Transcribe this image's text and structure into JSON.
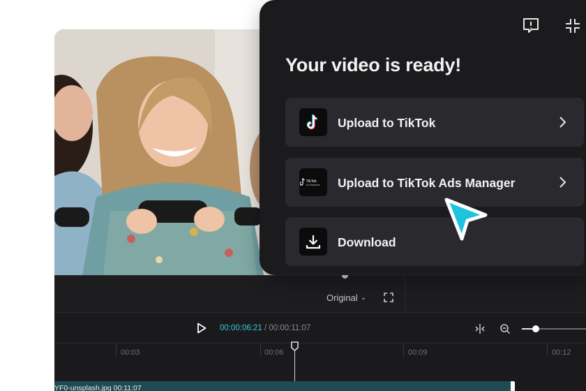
{
  "export_panel": {
    "title": "Your video is ready!",
    "options": [
      {
        "label": "Upload to TikTok",
        "icon": "tiktok-logo-icon"
      },
      {
        "label": "Upload to TikTok Ads Manager",
        "icon": "tiktok-for-business-logo-icon",
        "logo_text": "TikTok",
        "logo_subtext": "for Business"
      },
      {
        "label": "Download",
        "icon": "download-icon"
      }
    ],
    "header_icons": [
      "feedback-icon",
      "collapse-icon"
    ]
  },
  "preview": {
    "ratio_label": "Original"
  },
  "transport": {
    "current_time": "00:00:06:21",
    "separator": " / ",
    "total_time": "00:00:11:07"
  },
  "timeline": {
    "ticks": [
      "00:03",
      "00:06",
      "00:09",
      "00:12"
    ],
    "clip_label": "YF0-unsplash.jpg    00:11:07"
  },
  "colors": {
    "accent_cyan": "#3ac7d1",
    "panel_bg": "#1b1b1e",
    "option_bg": "#2a2a2e",
    "track_bg": "#1f4b52",
    "cursor": "#1ec4dd"
  }
}
